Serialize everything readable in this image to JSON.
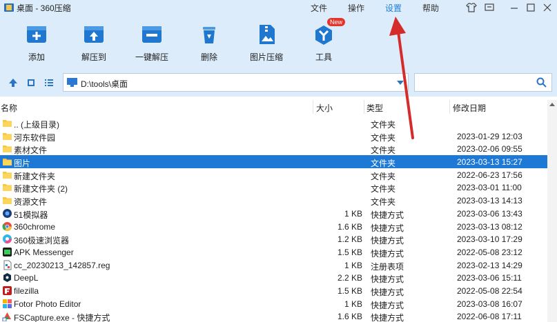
{
  "window": {
    "title": "桌面 - 360压缩",
    "menu": [
      "文件",
      "操作",
      "设置",
      "帮助"
    ],
    "active_menu_index": 2
  },
  "toolbar": {
    "items": [
      {
        "label": "添加",
        "icon": "add-icon"
      },
      {
        "label": "解压到",
        "icon": "extract-to-icon"
      },
      {
        "label": "一键解压",
        "icon": "one-click-extract-icon"
      },
      {
        "label": "删除",
        "icon": "delete-icon"
      },
      {
        "label": "图片压缩",
        "icon": "image-compress-icon"
      },
      {
        "label": "工具",
        "icon": "tools-icon",
        "badge": "New"
      }
    ]
  },
  "address": {
    "path": "D:\\tools\\桌面",
    "search_placeholder": ""
  },
  "columns": {
    "name": "名称",
    "size": "大小",
    "type": "类型",
    "modified": "修改日期"
  },
  "files": [
    {
      "name": ".. (上级目录)",
      "size": "",
      "type": "文件夹",
      "date": "",
      "icon": "folder-icon"
    },
    {
      "name": "河东软件园",
      "size": "",
      "type": "文件夹",
      "date": "2023-01-29 12:03",
      "icon": "folder-icon"
    },
    {
      "name": "素材文件",
      "size": "",
      "type": "文件夹",
      "date": "2023-02-06 09:55",
      "icon": "folder-icon"
    },
    {
      "name": "图片",
      "size": "",
      "type": "文件夹",
      "date": "2023-03-13 15:27",
      "icon": "folder-icon",
      "selected": true
    },
    {
      "name": "新建文件夹",
      "size": "",
      "type": "文件夹",
      "date": "2022-06-23 17:56",
      "icon": "folder-icon"
    },
    {
      "name": "新建文件夹 (2)",
      "size": "",
      "type": "文件夹",
      "date": "2023-03-01 11:00",
      "icon": "folder-icon"
    },
    {
      "name": "资源文件",
      "size": "",
      "type": "文件夹",
      "date": "2023-03-13 14:13",
      "icon": "folder-icon"
    },
    {
      "name": "51模拟器",
      "size": "1 KB",
      "type": "快捷方式",
      "date": "2023-03-06 13:43",
      "icon": "emulator-icon"
    },
    {
      "name": "360chrome",
      "size": "1.6 KB",
      "type": "快捷方式",
      "date": "2023-03-13 08:12",
      "icon": "chrome-icon"
    },
    {
      "name": "360极速浏览器",
      "size": "1.2 KB",
      "type": "快捷方式",
      "date": "2023-03-10 17:29",
      "icon": "browser-icon"
    },
    {
      "name": "APK Messenger",
      "size": "1.5 KB",
      "type": "快捷方式",
      "date": "2022-05-08 23:12",
      "icon": "apk-icon"
    },
    {
      "name": "cc_20230213_142857.reg",
      "size": "1 KB",
      "type": "注册表项",
      "date": "2023-02-13 14:29",
      "icon": "registry-icon"
    },
    {
      "name": "DeepL",
      "size": "2.2 KB",
      "type": "快捷方式",
      "date": "2023-03-06 15:11",
      "icon": "deepl-icon"
    },
    {
      "name": "filezilla",
      "size": "1.5 KB",
      "type": "快捷方式",
      "date": "2022-05-08 22:54",
      "icon": "filezilla-icon"
    },
    {
      "name": "Fotor Photo Editor",
      "size": "1 KB",
      "type": "快捷方式",
      "date": "2023-03-08 16:07",
      "icon": "fotor-icon"
    },
    {
      "name": "FSCapture.exe - 快捷方式",
      "size": "1.6 KB",
      "type": "快捷方式",
      "date": "2022-06-08 17:11",
      "icon": "fscapture-icon"
    }
  ],
  "colors": {
    "toolbar_bg": "#dcecfa",
    "accent": "#1e78d6",
    "annotation": "#d42b2b"
  }
}
